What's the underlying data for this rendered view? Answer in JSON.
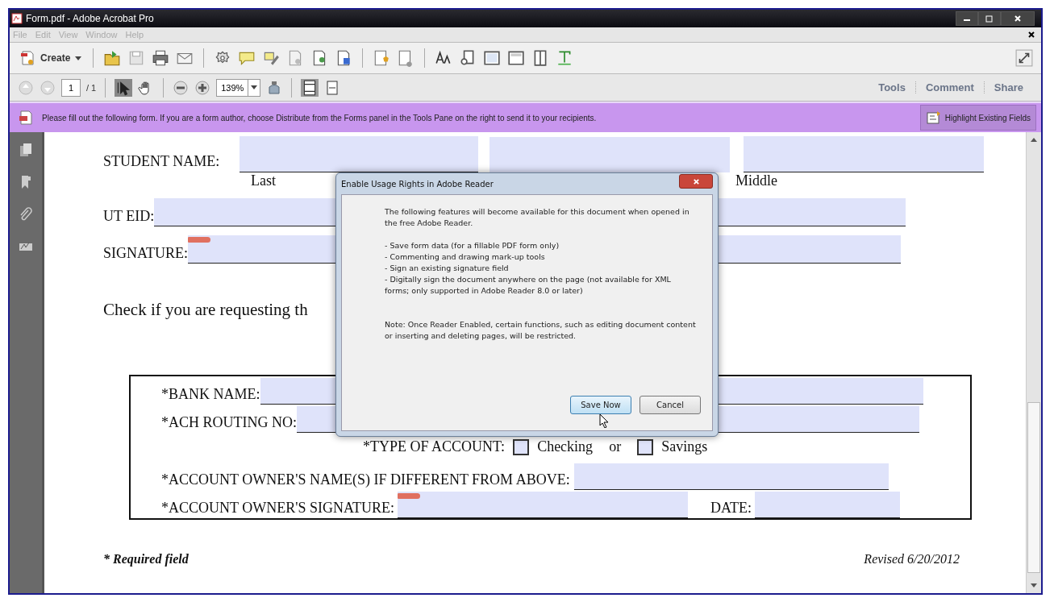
{
  "window": {
    "title": "Form.pdf - Adobe Acrobat Pro"
  },
  "menu": [
    {
      "label": "File",
      "disabled": true
    },
    {
      "label": "Edit",
      "disabled": true
    },
    {
      "label": "View",
      "disabled": true
    },
    {
      "label": "Window",
      "disabled": true
    },
    {
      "label": "Help",
      "disabled": true
    }
  ],
  "toolbar": {
    "create": "Create"
  },
  "navigation": {
    "page": "1",
    "total": "/ 1",
    "zoom": "139%"
  },
  "panes": [
    {
      "label": "Tools"
    },
    {
      "label": "Comment"
    },
    {
      "label": "Share"
    }
  ],
  "info_bar": {
    "message": "Please fill out the following form. If you are a form author, choose Distribute from the Forms panel in the Tools Pane on the right to send it to your recipients.",
    "button": "Highlight Existing Fields"
  },
  "form": {
    "student_name": "STUDENT NAME:",
    "name_parts": [
      "Last",
      "Middle"
    ],
    "ut_eid": "UT EID:",
    "signature": "SIGNATURE:",
    "check_text": "Check if you are requesting th",
    "bank_name": "*BANK NAME:",
    "routing": "*ACH ROUTING NO:",
    "account_type": "*TYPE OF ACCOUNT:",
    "account_options": [
      {
        "label": "Checking",
        "checked": false
      },
      {
        "label": "Savings",
        "checked": false
      }
    ],
    "or": "or",
    "owner_name": "*ACCOUNT OWNER'S NAME(S) IF DIFFERENT FROM ABOVE:",
    "owner_signature": "*ACCOUNT OWNER'S SIGNATURE:",
    "date": "DATE:",
    "required": "* Required field",
    "revised": "Revised 6/20/2012"
  },
  "dialog": {
    "title": "Enable Usage Rights in Adobe Reader",
    "intro": "The following features will become available for this document when opened in the free Adobe Reader.",
    "features": [
      "- Save form data (for a fillable PDF form only)",
      "- Commenting and drawing mark-up tools",
      "- Sign an existing signature field",
      "- Digitally sign the document anywhere on the page (not available for XML forms; only supported in Adobe Reader 8.0 or later)"
    ],
    "note": "Note: Once Reader Enabled, certain functions, such as editing document content or inserting and deleting pages, will be restricted.",
    "buttons": [
      {
        "label": "Save Now",
        "default": true
      },
      {
        "label": "Cancel",
        "default": false
      }
    ]
  }
}
